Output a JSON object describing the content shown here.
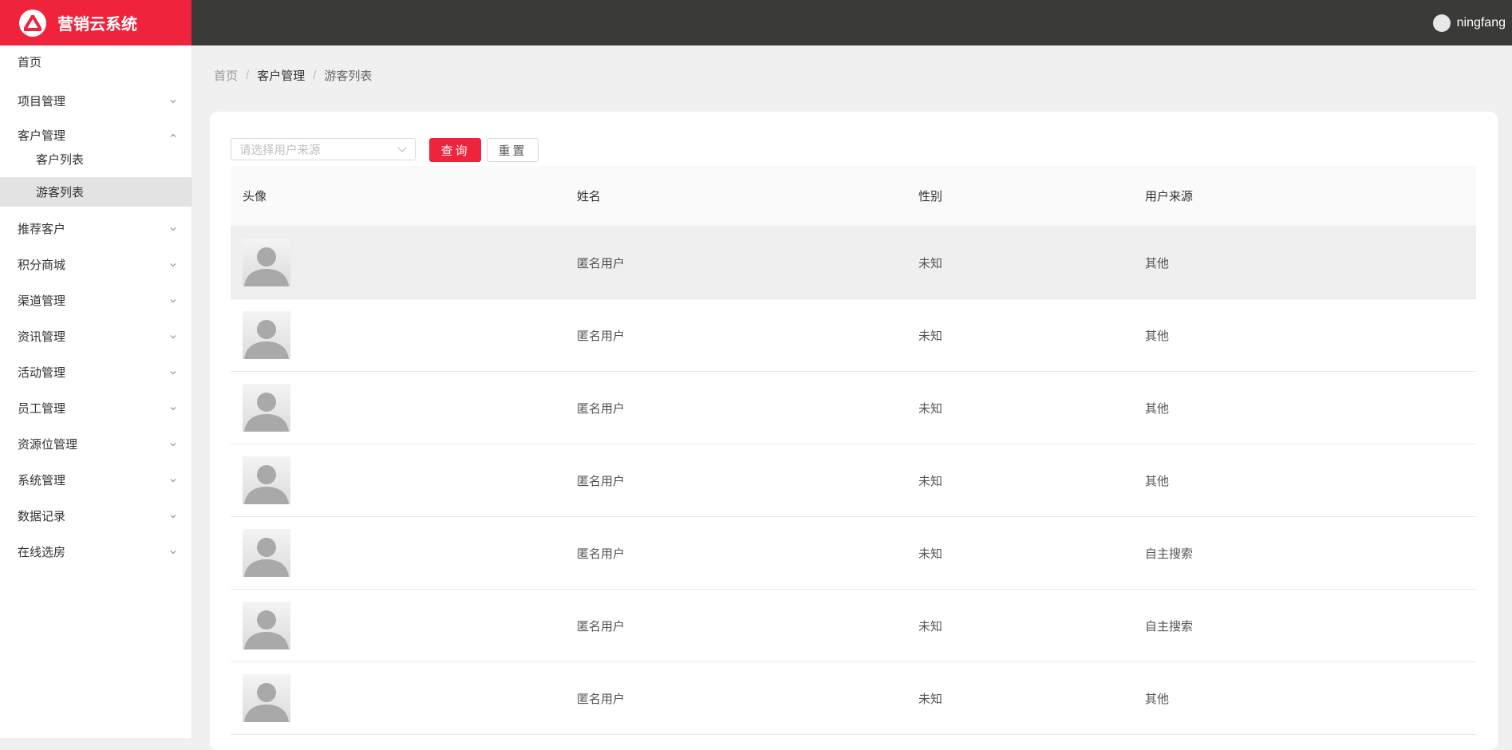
{
  "app": {
    "title": "营销云系统",
    "brand_color": "#f0233c",
    "logo_icon": "triangle-logo-icon"
  },
  "header": {
    "username": "ningfang"
  },
  "sidebar": {
    "items": [
      {
        "label": "首页",
        "has_chevron": false
      },
      {
        "label": "项目管理",
        "has_chevron": true,
        "expanded": false
      },
      {
        "label": "客户管理",
        "has_chevron": true,
        "expanded": true
      },
      {
        "label": "客户列表",
        "sub": true
      },
      {
        "label": "游客列表",
        "sub": true,
        "selected": true
      },
      {
        "label": "推荐客户",
        "has_chevron": true,
        "expanded": false
      },
      {
        "label": "积分商城",
        "has_chevron": true,
        "expanded": false
      },
      {
        "label": "渠道管理",
        "has_chevron": true,
        "expanded": false
      },
      {
        "label": "资讯管理",
        "has_chevron": true,
        "expanded": false
      },
      {
        "label": "活动管理",
        "has_chevron": true,
        "expanded": false
      },
      {
        "label": "员工管理",
        "has_chevron": true,
        "expanded": false
      },
      {
        "label": "资源位管理",
        "has_chevron": true,
        "expanded": false
      },
      {
        "label": "系统管理",
        "has_chevron": true,
        "expanded": false
      },
      {
        "label": "数据记录",
        "has_chevron": true,
        "expanded": false
      },
      {
        "label": "在线选房",
        "has_chevron": true,
        "expanded": false
      }
    ]
  },
  "breadcrumb": {
    "home": "首页",
    "section": "客户管理",
    "current": "游客列表",
    "separator": "/"
  },
  "filters": {
    "source_placeholder": "请选择用户来源",
    "query_label": "查询",
    "reset_label": "重置"
  },
  "table": {
    "columns": [
      "头像",
      "姓名",
      "性别",
      "用户来源"
    ],
    "rows": [
      {
        "name": "匿名用户",
        "gender": "未知",
        "source": "其他"
      },
      {
        "name": "匿名用户",
        "gender": "未知",
        "source": "其他"
      },
      {
        "name": "匿名用户",
        "gender": "未知",
        "source": "其他"
      },
      {
        "name": "匿名用户",
        "gender": "未知",
        "source": "其他"
      },
      {
        "name": "匿名用户",
        "gender": "未知",
        "source": "自主搜索"
      },
      {
        "name": "匿名用户",
        "gender": "未知",
        "source": "自主搜索"
      },
      {
        "name": "匿名用户",
        "gender": "未知",
        "source": "其他"
      }
    ]
  }
}
